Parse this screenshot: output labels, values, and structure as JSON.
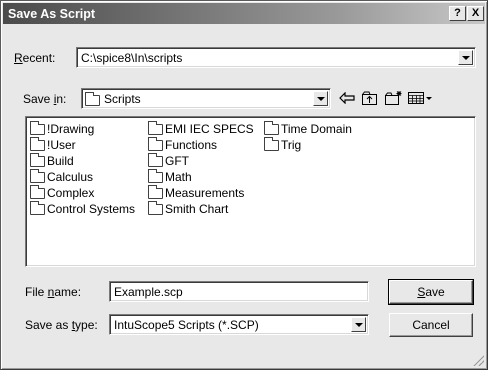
{
  "dialog": {
    "title": "Save As Script",
    "help_glyph": "?",
    "close_glyph": "X"
  },
  "recent": {
    "label_prefix": "",
    "label_hotkey": "R",
    "label_rest": "ecent:",
    "value": "C:\\spice8\\In\\scripts"
  },
  "save_in": {
    "label_prefix": "Save ",
    "label_hotkey": "i",
    "label_rest": "n:",
    "value": "Scripts",
    "toolbar_icons": [
      "back-arrow-icon",
      "up-folder-icon",
      "new-folder-icon",
      "view-menu-icon"
    ]
  },
  "folders": {
    "col1": [
      "!Drawing",
      "!User",
      "Build",
      "Calculus",
      "Complex",
      "Control Systems"
    ],
    "col2": [
      "EMI IEC SPECS",
      "Functions",
      "GFT",
      "Math",
      "Measurements",
      "Smith Chart"
    ],
    "col3": [
      "Time Domain",
      "Trig"
    ]
  },
  "file_name": {
    "label_prefix": "File ",
    "label_hotkey": "n",
    "label_rest": "ame:",
    "value": "Example.scp"
  },
  "save_as_type": {
    "label_prefix": "Save as ",
    "label_hotkey": "t",
    "label_rest": "ype:",
    "value": "IntuScope5 Scripts (*.SCP)"
  },
  "buttons": {
    "save_hotkey": "S",
    "save_rest": "ave",
    "cancel": "Cancel"
  }
}
